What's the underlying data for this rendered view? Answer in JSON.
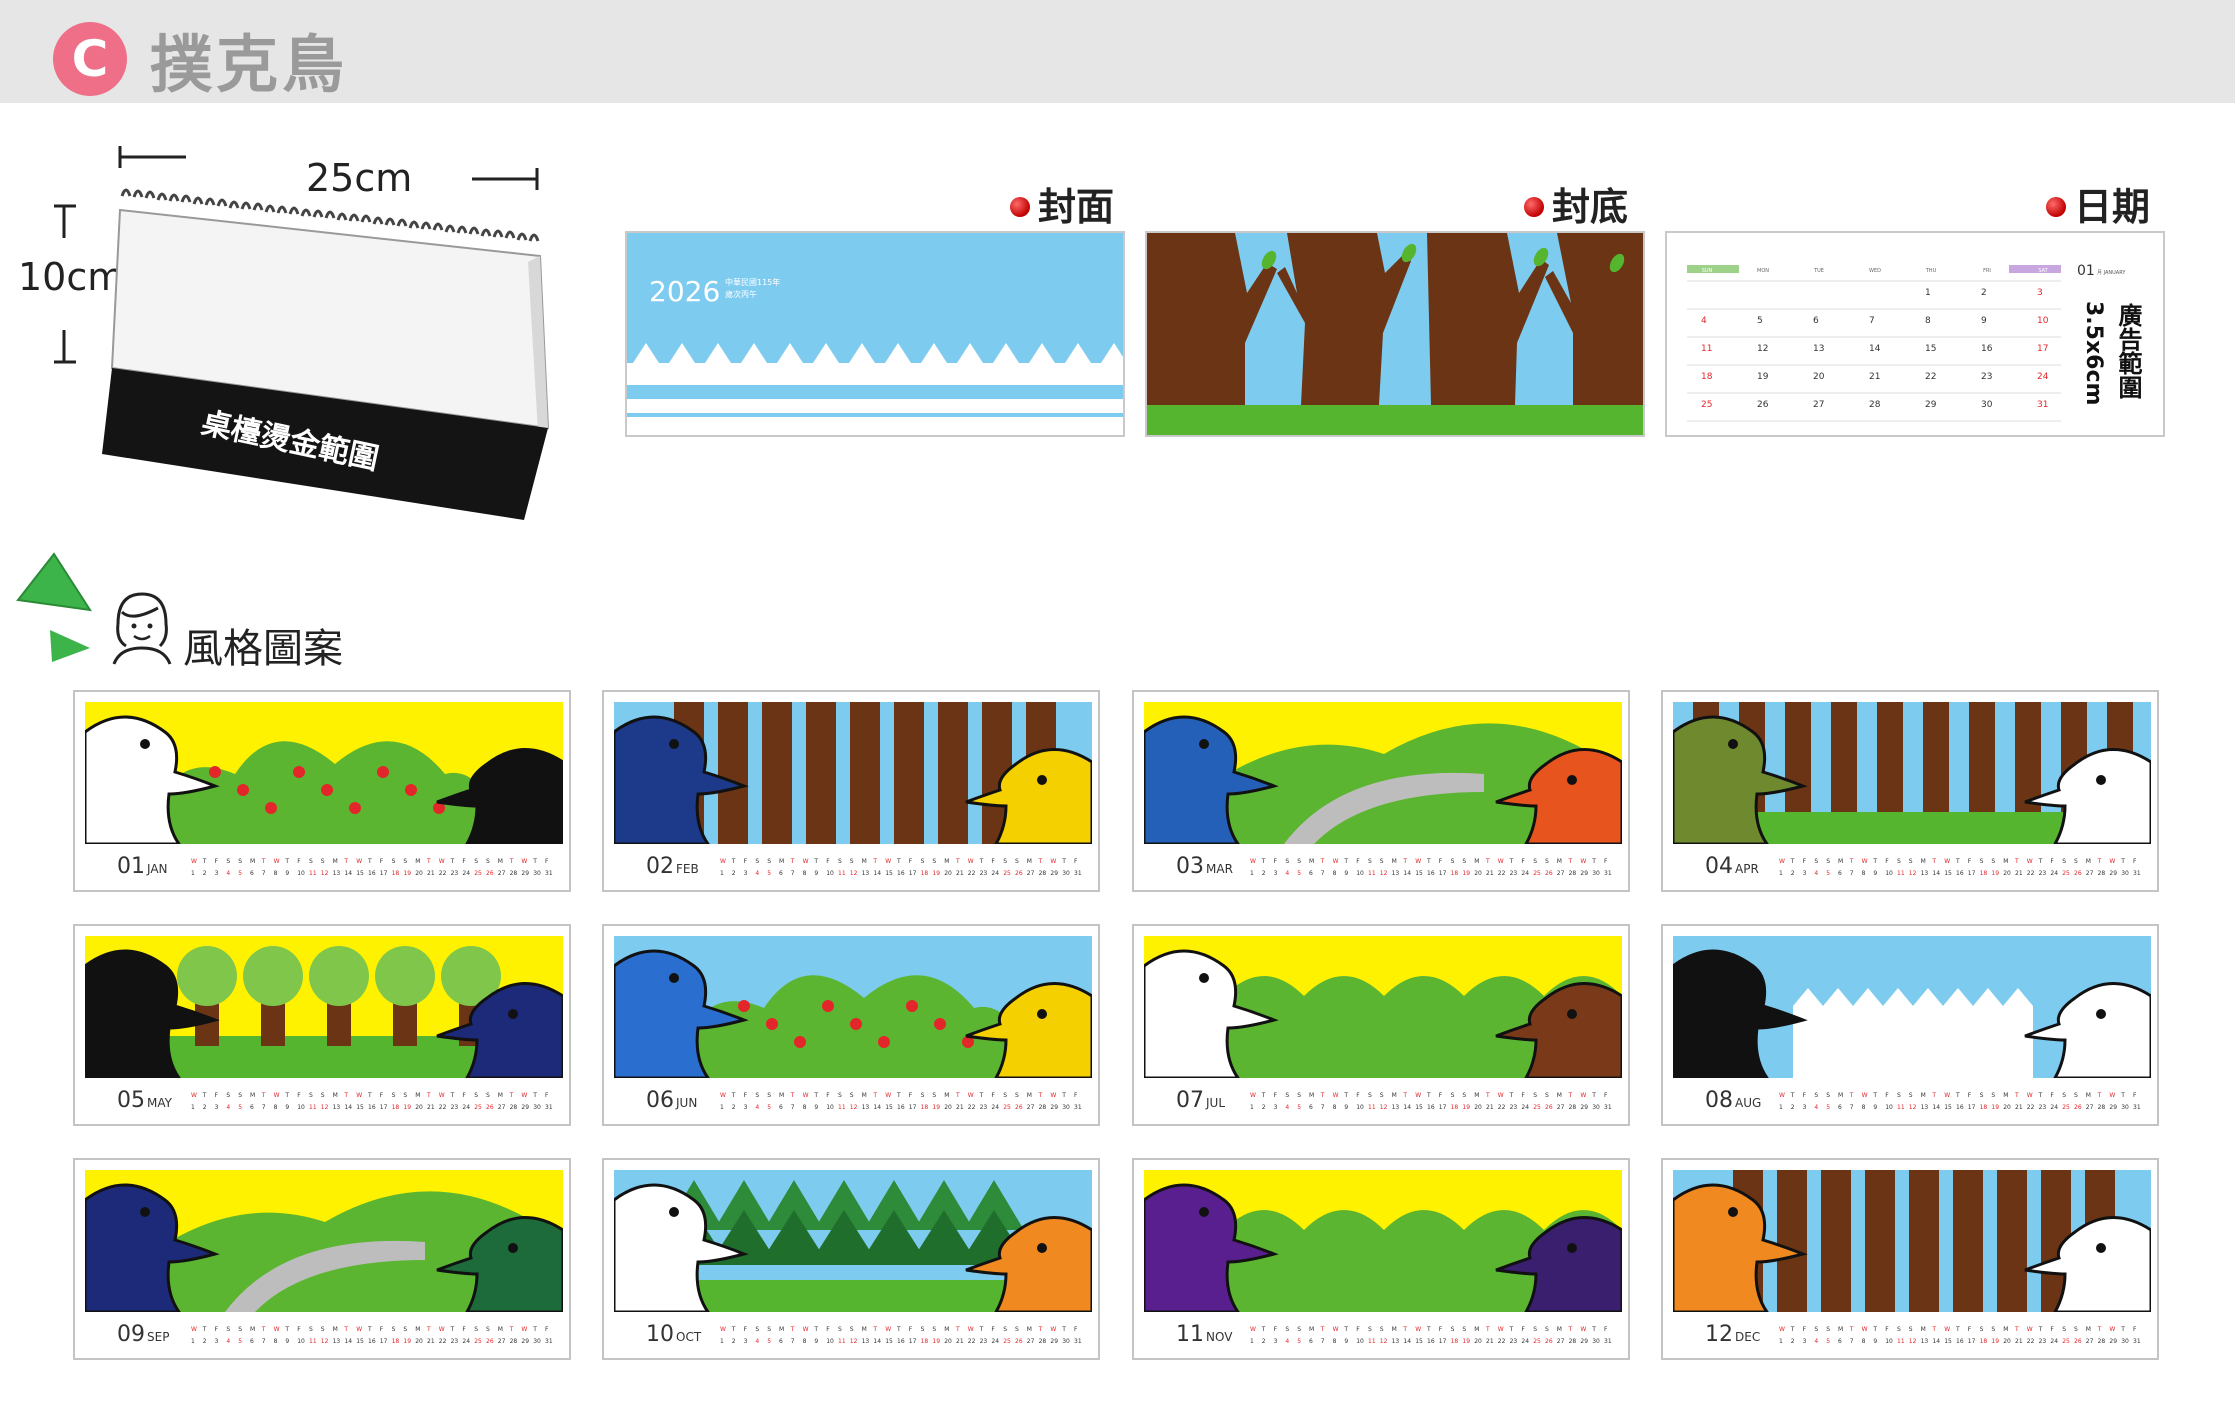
{
  "header": {
    "badge": "C",
    "title": "撲克鳥"
  },
  "product": {
    "width_label": "25cm",
    "height_label": "10cm",
    "stamp_text": "桌檯燙金範圍"
  },
  "samples": {
    "cover_label": "封面",
    "back_label": "封底",
    "date_label": "日期",
    "cover_year": "2026",
    "cover_line1": "中華民國115年",
    "cover_line2": "歲次丙午",
    "ad_area_label": "廣告範圍",
    "ad_area_size": "3.5x6cm",
    "date_month": "01",
    "date_month_name": "月 JANUARY",
    "weekday_headers": [
      "SUN",
      "MON",
      "TUE",
      "WED",
      "THU",
      "FRI",
      "SAT"
    ]
  },
  "style_section": {
    "heading": "風格圖案"
  },
  "months": [
    {
      "num": "01",
      "abbr": "JAN"
    },
    {
      "num": "02",
      "abbr": "FEB"
    },
    {
      "num": "03",
      "abbr": "MAR"
    },
    {
      "num": "04",
      "abbr": "APR"
    },
    {
      "num": "05",
      "abbr": "MAY"
    },
    {
      "num": "06",
      "abbr": "JUN"
    },
    {
      "num": "07",
      "abbr": "JUL"
    },
    {
      "num": "08",
      "abbr": "AUG"
    },
    {
      "num": "09",
      "abbr": "SEP"
    },
    {
      "num": "10",
      "abbr": "OCT"
    },
    {
      "num": "11",
      "abbr": "NOV"
    },
    {
      "num": "12",
      "abbr": "DEC"
    }
  ],
  "colors": {
    "badge": "#ee6f87",
    "sky_blue": "#7ecbf0",
    "yellow": "#fff200",
    "green": "#5cb531",
    "brown": "#6b3515",
    "accent_red": "#e2262a"
  }
}
